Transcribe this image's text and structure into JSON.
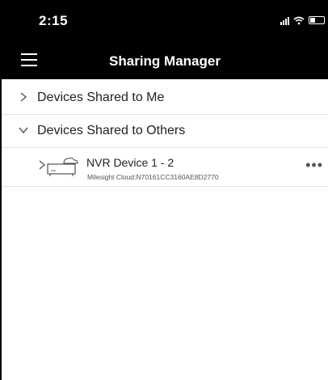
{
  "status_bar": {
    "time": "2:15"
  },
  "header": {
    "title": "Sharing Manager"
  },
  "sections": [
    {
      "label": "Devices Shared to Me",
      "expanded": false
    },
    {
      "label": "Devices Shared to Others",
      "expanded": true
    }
  ],
  "device": {
    "name": "NVR Device 1 - 2",
    "subtitle": "Milesight Cloud:N70161CC3160AE8D2770",
    "more_label": "•••"
  }
}
